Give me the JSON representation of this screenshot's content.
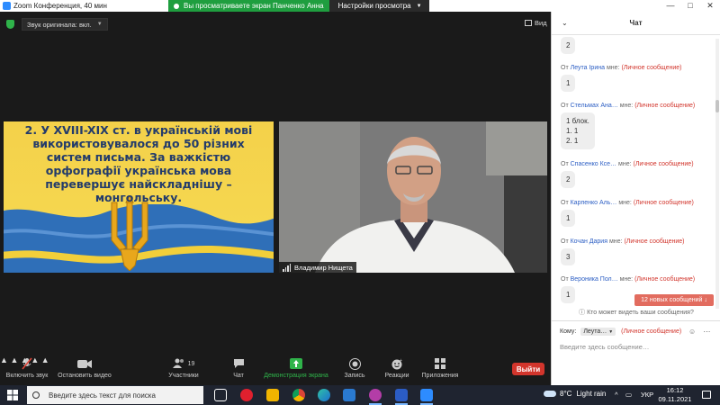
{
  "window": {
    "title": "Zoom Конференция, 40 мин",
    "share_notice": "Вы просматриваете экран Панченко Анна",
    "view_settings": "Настройки просмотра",
    "controls": [
      "—",
      "□",
      "✕"
    ]
  },
  "meeting": {
    "original_sound": "Звук оригинала: вкл.",
    "view_label": "Вид",
    "slide": {
      "text": "2. У XVIII-XIX ст. в українській мові використовувалося до 50 різних систем письма. За важкістю орфографії українська мова перевершує найскладнішу – монгольську."
    },
    "speaker_name": "Владимир Нищета"
  },
  "toolbar": {
    "mute": "Включить звук",
    "video": "Остановить видео",
    "participants": "Участники",
    "participants_count": "19",
    "chat": "Чат",
    "share": "Демонстрация экрана",
    "record": "Запись",
    "reactions": "Реакции",
    "apps": "Приложения",
    "leave": "Выйти",
    "colors": {
      "share_green": "#2fb34a",
      "leave_red": "#d2352c"
    }
  },
  "chat": {
    "title": "Чат",
    "top_bubble": "2",
    "messages": [
      {
        "prefix": "От",
        "sender": "Леута Ірина",
        "to": "мне:",
        "private": "(Личное сообщение)",
        "text": "1"
      },
      {
        "prefix": "От",
        "sender": "Стельмах Ана…",
        "to": "мне:",
        "private": "(Личное сообщение)",
        "lines": [
          "1 блок.",
          "1. 1",
          "2. 1"
        ]
      },
      {
        "prefix": "От",
        "sender": "Спасенко Ксе…",
        "to": "мне:",
        "private": "(Личное сообщение)",
        "text": "2"
      },
      {
        "prefix": "От",
        "sender": "Карпенко Аль…",
        "to": "мне:",
        "private": "(Личное сообщение)",
        "text": "1"
      },
      {
        "prefix": "От",
        "sender": "Кочан Дария",
        "to": "мне:",
        "private": "(Личное сообщение)",
        "text": "3"
      },
      {
        "prefix": "От",
        "sender": "Вероника Пол…",
        "to": "мне:",
        "private": "(Личное сообщение)",
        "text": "1"
      }
    ],
    "new_messages": "12 новых сообщений ↓",
    "who_can_see": "Кто может видеть ваши сообщения?",
    "to_label": "Кому:",
    "to_value": "Леута…",
    "to_private": "(Личное сообщение)",
    "input_placeholder": "Введите здесь сообщение…",
    "accent_blue": "#2d5fc4",
    "private_red": "#d2352c"
  },
  "taskbar": {
    "search_placeholder": "Введите здесь текст для поиска",
    "temperature": "8°C",
    "weather": "Light rain",
    "lang": "УКР",
    "time": "16:12",
    "date": "09.11.2021"
  }
}
